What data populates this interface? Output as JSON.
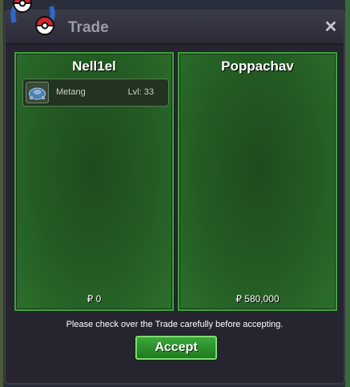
{
  "window": {
    "title": "Trade",
    "close_icon": "close-icon",
    "logo_icon": "pokeball-trade-icon"
  },
  "left_panel": {
    "player": "Nell1el",
    "items": [
      {
        "icon": "metang-icon",
        "name": "Metang",
        "level": "Lvl: 33"
      }
    ],
    "money": "₽ 0"
  },
  "right_panel": {
    "player": "Poppachav",
    "items": [],
    "money": "₽ 580,000"
  },
  "notice": "Please check over the Trade carefully before accepting.",
  "accept_label": "Accept",
  "colors": {
    "panel_border": "#3da33a",
    "panel_fill": "#235c23",
    "button": "#2e922e"
  }
}
